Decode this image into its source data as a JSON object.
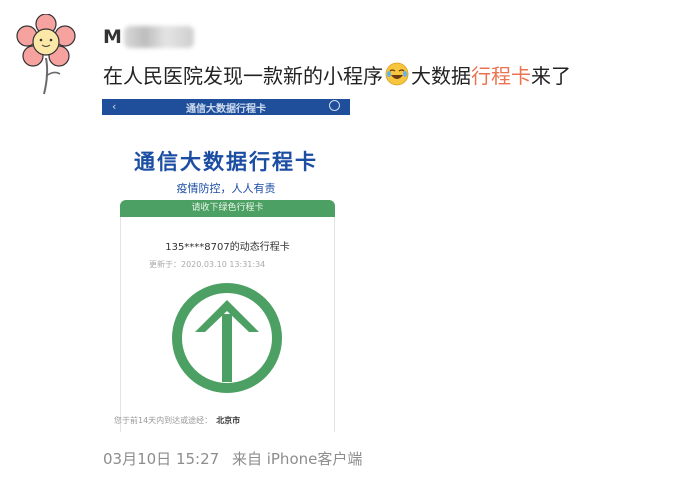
{
  "post": {
    "username_initial": "M",
    "text_before_emoji": "在人民医院发现一款新的小程序",
    "emoji": "crying-laughing-emoji",
    "text_after_emoji": "大数据",
    "link_text": "行程卡",
    "text_end": "来了",
    "date": "03月10日 15:27",
    "source": "来自 iPhone客户端"
  },
  "screenshot": {
    "nav_title": "通信大数据行程卡",
    "title": "通信大数据行程卡",
    "subtitle": "疫情防控，人人有责",
    "card_header": "请收下绿色行程卡",
    "phone_line": "135****8707的动态行程卡",
    "updated": "更新于：2020.03.10 13:31:34",
    "footer_label": "您于前14天内到达或途经：",
    "footer_city": "北京市"
  },
  "colors": {
    "link": "#eb7350",
    "title_blue": "#1b4da3",
    "pass_green": "#4da063",
    "nav_blue": "#1f4f9a",
    "meta_grey": "#8d8d8d"
  }
}
